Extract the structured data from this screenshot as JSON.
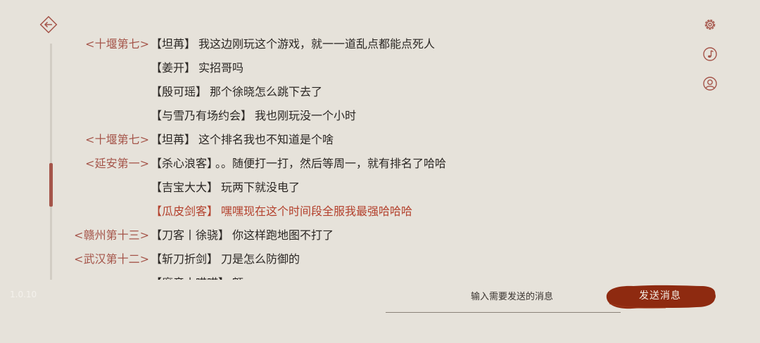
{
  "colors": {
    "background": "#e6e2da",
    "accent": "#a5554a",
    "highlight_text": "#b3402c",
    "send_button": "#8e2a10"
  },
  "icons": {
    "back": "back-arrow-icon",
    "settings": "gear-icon",
    "music": "music-note-icon",
    "profile": "user-icon"
  },
  "scroll_position": 0.62,
  "version": "1.0.10",
  "messages": [
    {
      "region": "<十堰第七>",
      "name": "【坦苒】",
      "text": "我这边刚玩这个游戏，就一一道乱点都能点死人",
      "highlight": false
    },
    {
      "region": "",
      "name": "【姜开】",
      "text": "实招哥吗",
      "highlight": false
    },
    {
      "region": "",
      "name": "【殷可瑶】",
      "text": "那个徐晓怎么跳下去了",
      "highlight": false
    },
    {
      "region": "",
      "name": "【与雪乃有场约会】",
      "text": "我也刚玩没一个小时",
      "highlight": false
    },
    {
      "region": "<十堰第七>",
      "name": "【坦苒】",
      "text": "这个排名我也不知道是个啥",
      "highlight": false
    },
    {
      "region": "<延安第一>",
      "name": "【杀心浪客】",
      "text": "。。随便打一打，然后等周一，就有排名了哈哈",
      "highlight": false
    },
    {
      "region": "",
      "name": "【吉宝大大】",
      "text": "玩两下就没电了",
      "highlight": false
    },
    {
      "region": "",
      "name": "【瓜皮剑客】",
      "text": "嘿嘿现在这个时间段全服我最强哈哈哈",
      "highlight": true
    },
    {
      "region": "<赣州第十三>",
      "name": "【刀客丨徐骁】",
      "text": "你这样跑地图不打了",
      "highlight": false
    },
    {
      "region": "<武汉第十二>",
      "name": "【斩刀折剑】",
      "text": "刀是怎么防御的",
      "highlight": false
    },
    {
      "region": "",
      "name": "【魔音小喵喵】",
      "text": "额",
      "highlight": false
    }
  ],
  "input": {
    "placeholder": "输入需要发送的消息",
    "value": ""
  },
  "send_button": {
    "label": "发送消息"
  }
}
